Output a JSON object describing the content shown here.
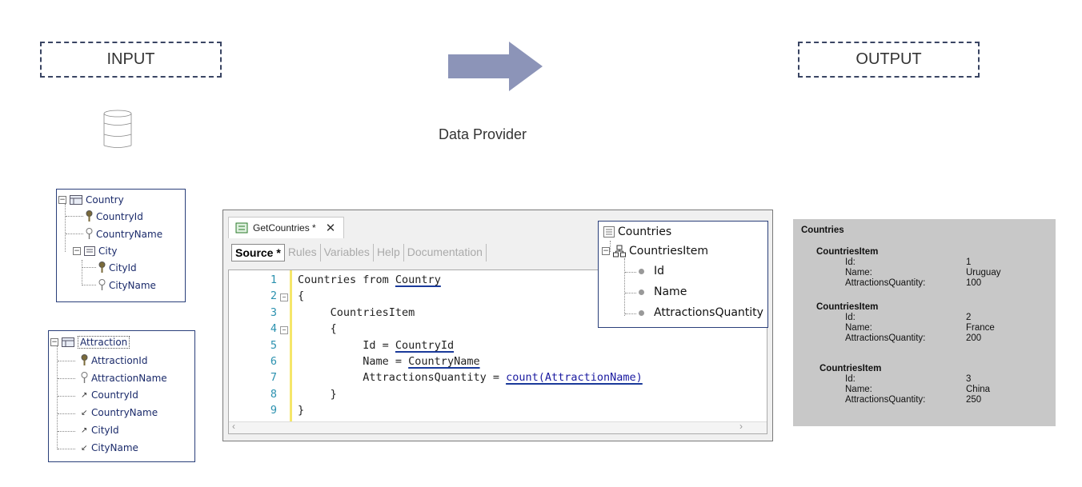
{
  "input_label": "INPUT",
  "output_label": "OUTPUT",
  "arrow_label": "Data Provider",
  "country_tree": {
    "root": "Country",
    "items": [
      "CountryId",
      "CountryName"
    ],
    "sub": "City",
    "sub_items": [
      "CityId",
      "CityName"
    ]
  },
  "attraction_tree": {
    "root": "Attraction",
    "items": [
      "AttractionId",
      "AttractionName",
      "CountryId",
      "CountryName",
      "CityId",
      "CityName"
    ]
  },
  "editor": {
    "tab_title": "GetCountries *",
    "close_glyph": "✕",
    "subtabs": [
      "Source *",
      "Rules",
      "Variables",
      "Help",
      "Documentation"
    ],
    "lines": [
      {
        "n": "1",
        "pre": "Countries from ",
        "u": "Country",
        "post": ""
      },
      {
        "n": "2",
        "pre": "{",
        "u": "",
        "post": ""
      },
      {
        "n": "3",
        "pre": "     CountriesItem",
        "u": "",
        "post": ""
      },
      {
        "n": "4",
        "pre": "     {",
        "u": "",
        "post": ""
      },
      {
        "n": "5",
        "pre": "          Id = ",
        "u": "CountryId",
        "post": ""
      },
      {
        "n": "6",
        "pre": "          Name = ",
        "u": "CountryName",
        "post": ""
      },
      {
        "n": "7",
        "pre": "          AttractionsQuantity = ",
        "u": "count(AttractionName)",
        "post": ""
      },
      {
        "n": "8",
        "pre": "     }",
        "u": "",
        "post": ""
      },
      {
        "n": "9",
        "pre": "}",
        "u": "",
        "post": ""
      }
    ]
  },
  "sdt_tree": {
    "root": "Countries",
    "item": "CountriesItem",
    "fields": [
      "Id",
      "Name",
      "AttractionsQuantity"
    ]
  },
  "output": {
    "title": "Countries",
    "item_label": "CountriesItem",
    "keys": [
      "Id:",
      "Name:",
      "AttractionsQuantity:"
    ],
    "records": [
      {
        "id": "1",
        "name": "Uruguay",
        "qty": "100"
      },
      {
        "id": "2",
        "name": "France",
        "qty": "200"
      },
      {
        "id": "3",
        "name": "China",
        "qty": "250"
      }
    ]
  },
  "colors": {
    "accent_arrow": "#8c94b8",
    "panel_border": "#2a3f7a",
    "output_bg": "#c8c8c8",
    "line_number": "#2b91af",
    "change_bar": "#f5e66a"
  }
}
